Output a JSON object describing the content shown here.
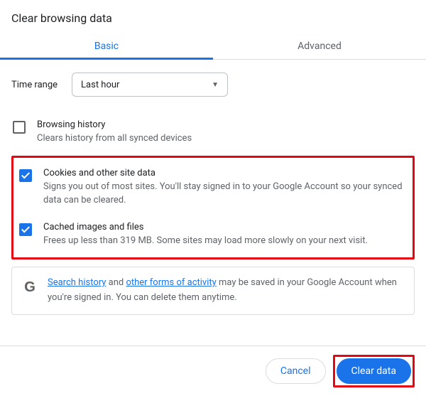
{
  "title": "Clear browsing data",
  "tabs": {
    "basic": "Basic",
    "advanced": "Advanced",
    "active": "basic"
  },
  "timerange": {
    "label": "Time range",
    "value": "Last hour"
  },
  "options": [
    {
      "id": "browsing-history",
      "checked": false,
      "title": "Browsing history",
      "desc": "Clears history from all synced devices"
    },
    {
      "id": "cookies",
      "checked": true,
      "title": "Cookies and other site data",
      "desc": "Signs you out of most sites. You'll stay signed in to your Google Account so your synced data can be cleared."
    },
    {
      "id": "cache",
      "checked": true,
      "title": "Cached images and files",
      "desc": "Frees up less than 319 MB. Some sites may load more slowly on your next visit."
    }
  ],
  "info": {
    "link1": "Search history",
    "mid1": " and ",
    "link2": "other forms of activity",
    "rest": " may be saved in your Google Account when you're signed in. You can delete them anytime."
  },
  "buttons": {
    "cancel": "Cancel",
    "clear": "Clear data"
  },
  "colors": {
    "accent": "#1a73e8",
    "highlight": "#e30613"
  }
}
